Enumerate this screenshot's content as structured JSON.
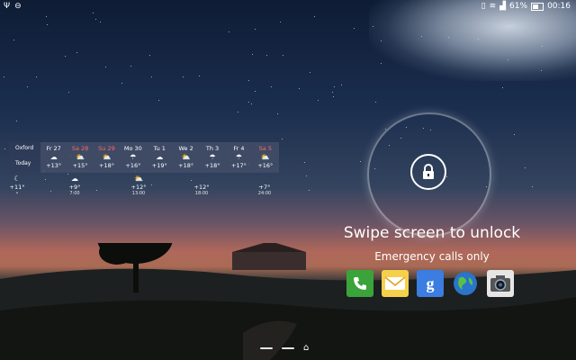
{
  "status_bar": {
    "left_icons": [
      "usb-icon",
      "do-not-disturb-icon"
    ],
    "right_icons": [
      "vibrate-icon",
      "wifi-icon",
      "signal-icon"
    ],
    "battery_percent": "61%",
    "battery_level": 0.61,
    "time": "00:16"
  },
  "weather": {
    "location": "Oxford",
    "today_label": "Today",
    "days": [
      {
        "name": "Fr 27",
        "temp": "+13°",
        "icon": "cloud-icon",
        "weekend": false
      },
      {
        "name": "Sa 28",
        "temp": "+15°",
        "icon": "partly-sunny-icon",
        "weekend": true
      },
      {
        "name": "Su 29",
        "temp": "+18°",
        "icon": "partly-sunny-icon",
        "weekend": true
      },
      {
        "name": "Mo 30",
        "temp": "+16°",
        "icon": "rain-icon",
        "weekend": false
      },
      {
        "name": "Tu 1",
        "temp": "+19°",
        "icon": "cloud-icon",
        "weekend": false
      },
      {
        "name": "We 2",
        "temp": "+18°",
        "icon": "partly-sunny-icon",
        "weekend": false
      },
      {
        "name": "Th 3",
        "temp": "+18°",
        "icon": "rain-icon",
        "weekend": false
      },
      {
        "name": "Fr 4",
        "temp": "+17°",
        "icon": "rain-icon",
        "weekend": false
      },
      {
        "name": "Sa 5",
        "temp": "+16°",
        "icon": "partly-sunny-icon",
        "weekend": true
      }
    ],
    "hourly": [
      {
        "temp": "+11°",
        "time": "•",
        "icon": "moon-cloud-icon"
      },
      {
        "temp": "+9°",
        "time": "7:00",
        "icon": "cloud-icon"
      },
      {
        "temp": "+12°",
        "time": "13:00",
        "icon": "partly-sunny-icon"
      },
      {
        "temp": "+12°",
        "time": "18:00",
        "icon": ""
      },
      {
        "temp": "+7°",
        "time": "24:00",
        "icon": ""
      }
    ]
  },
  "lockscreen": {
    "swipe_text": "Swipe screen to unlock",
    "emergency_text": "Emergency calls only"
  },
  "shortcuts": [
    {
      "name": "phone",
      "icon": "phone-icon",
      "color": "#3aa33a"
    },
    {
      "name": "email",
      "icon": "email-icon",
      "color": "#f2c93b"
    },
    {
      "name": "google",
      "icon": "google-icon",
      "color": "#3b7de0"
    },
    {
      "name": "internet",
      "icon": "globe-icon",
      "color": "#2a74c9"
    },
    {
      "name": "camera",
      "icon": "camera-icon",
      "color": "#d8d8d8"
    }
  ],
  "colors": {
    "weekend_red": "#ff6a6a",
    "accent_white": "#ffffff"
  }
}
